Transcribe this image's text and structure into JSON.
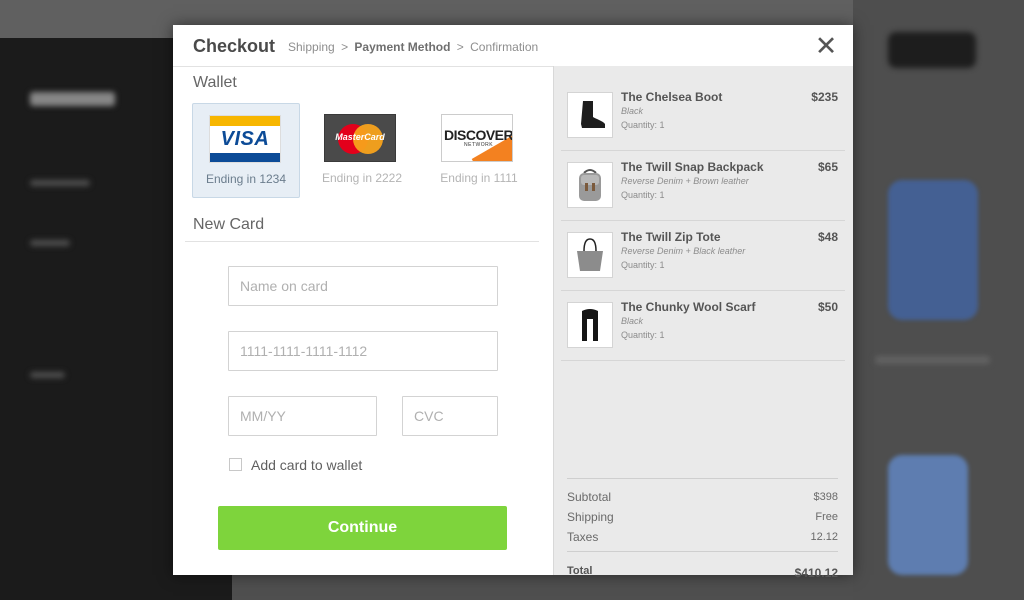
{
  "modal": {
    "title": "Checkout",
    "breadcrumb": {
      "step1": "Shipping",
      "sep": ">",
      "step2": "Payment Method",
      "step3": "Confirmation"
    },
    "close_glyph": "✕"
  },
  "wallet": {
    "title": "Wallet",
    "cards": [
      {
        "brand": "VISA",
        "label": "Ending in 1234",
        "selected": true
      },
      {
        "brand": "MasterCard",
        "label": "Ending in 2222",
        "selected": false
      },
      {
        "brand": "DISCOVER",
        "network": "NETWORK",
        "label": "Ending in 1111",
        "selected": false
      }
    ]
  },
  "new_card": {
    "title": "New Card",
    "name_placeholder": "Name on card",
    "number_placeholder": "1111-1111-1111-1112",
    "expiry_placeholder": "MM/YY",
    "cvc_placeholder": "CVC",
    "add_to_wallet_label": "Add card to wallet",
    "add_to_wallet_checked": false,
    "continue_label": "Continue"
  },
  "order": {
    "items": [
      {
        "name": "The Chelsea Boot",
        "variant": "Black",
        "qty_label": "Quantity:",
        "qty": "1",
        "price": "$235",
        "icon": "boot-icon"
      },
      {
        "name": "The Twill Snap Backpack",
        "variant": "Reverse Denim + Brown leather",
        "qty_label": "Quantity:",
        "qty": "1",
        "price": "$65",
        "icon": "backpack-icon"
      },
      {
        "name": "The Twill Zip Tote",
        "variant": "Reverse Denim + Black leather",
        "qty_label": "Quantity:",
        "qty": "1",
        "price": "$48",
        "icon": "tote-icon"
      },
      {
        "name": "The Chunky Wool Scarf",
        "variant": "Black",
        "qty_label": "Quantity:",
        "qty": "1",
        "price": "$50",
        "icon": "scarf-icon"
      }
    ],
    "subtotal_label": "Subtotal",
    "subtotal": "$398",
    "shipping_label": "Shipping",
    "shipping": "Free",
    "taxes_label": "Taxes",
    "taxes": "12.12",
    "total_label": "Total",
    "total": "$410.12"
  },
  "colors": {
    "accent_green": "#7ed43c",
    "visa_blue": "#0c4b97",
    "visa_gold": "#f7b600",
    "discover_orange": "#f38120",
    "selected_tile": "#e7eef5"
  }
}
